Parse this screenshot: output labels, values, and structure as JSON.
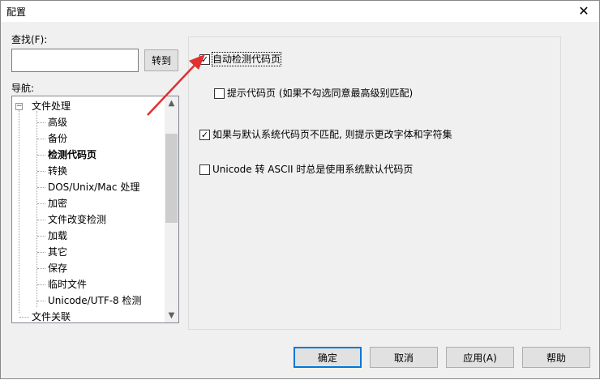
{
  "window": {
    "title": "配置",
    "close_glyph": "✕"
  },
  "search": {
    "label": "查找(F):",
    "value": "",
    "goto_button": "转到"
  },
  "nav": {
    "label": "导航:",
    "root": "文件处理",
    "items": [
      "高级",
      "备份",
      "检测代码页",
      "转换",
      "DOS/Unix/Mac 处理",
      "加密",
      "文件改变检测",
      "加载",
      "其它",
      "保存",
      "临时文件",
      "Unicode/UTF-8 检测"
    ],
    "next_root": "文件关联",
    "selected": "检测代码页"
  },
  "options": {
    "auto_detect": {
      "label": "自动检测代码页",
      "checked": true
    },
    "prompt_codepage": {
      "label": "提示代码页 (如果不勾选同意最高级别匹配)",
      "checked": false
    },
    "mismatch_prompt": {
      "label": "如果与默认系统代码页不匹配, 则提示更改字体和字符集",
      "checked": true
    },
    "unicode_ascii": {
      "label": "Unicode 转 ASCII 时总是使用系统默认代码页",
      "checked": false
    }
  },
  "buttons": {
    "ok": "确定",
    "cancel": "取消",
    "apply": "应用(A)",
    "help": "帮助"
  },
  "glyphs": {
    "check": "✓",
    "up": "▲",
    "down": "▼",
    "collapse": "−",
    "expand": "+"
  },
  "colors": {
    "arrow": "#e03030",
    "focus_border": "#0078d7"
  }
}
